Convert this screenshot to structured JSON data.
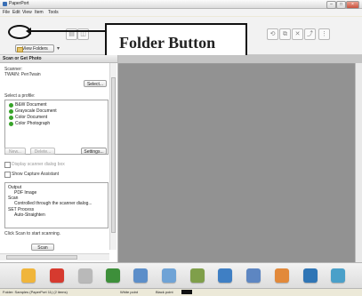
{
  "window": {
    "title": "PaperPort"
  },
  "menu": [
    "File",
    "Edit",
    "View",
    "Item",
    "Tools"
  ],
  "toolbar": {
    "view_folders_label": "View Folders"
  },
  "annotation": {
    "callout_text": "Folder Button"
  },
  "scan_panel": {
    "header": "Scan or Get Photo",
    "scanner_label": "Scanner:",
    "scanner_name": "TWAIN: PenTwain",
    "select_button": "Select...",
    "profile_label": "Select a profile:",
    "profiles": [
      "B&W Document",
      "Grayscale Document",
      "Color Document",
      "Color Photograph"
    ],
    "new_button": "New...",
    "delete_button": "Delete...",
    "settings_button": "Settings...",
    "display_dialog_label": "Display scanner dialog box",
    "capture_assistant_label": "Show Capture Assistant",
    "output_items": [
      "Output",
      "PDF Image",
      "Scan",
      "Controlled through the scanner dialog...",
      "SET Process",
      "Auto-Straighten"
    ],
    "hint": "Click Scan to start scanning.",
    "scan_button": "Scan"
  },
  "app_bar": {
    "icons": [
      "folder-app-icon",
      "pdf-app-icon",
      "tools-app-icon",
      "spreadsheet-app-icon",
      "image-app-icon",
      "document-app-icon",
      "camera-app-icon",
      "search-app-icon",
      "bookmark-app-icon",
      "mail-app-icon",
      "web-app-icon",
      "office-app-icon"
    ]
  },
  "status_bar": {
    "left": "Folder: Samples (PaperPort 11) (2 items)",
    "middle": "White point",
    "right": "Black point"
  },
  "colors": {
    "profile_dot": "#38a32a",
    "work_area": "#929292"
  }
}
